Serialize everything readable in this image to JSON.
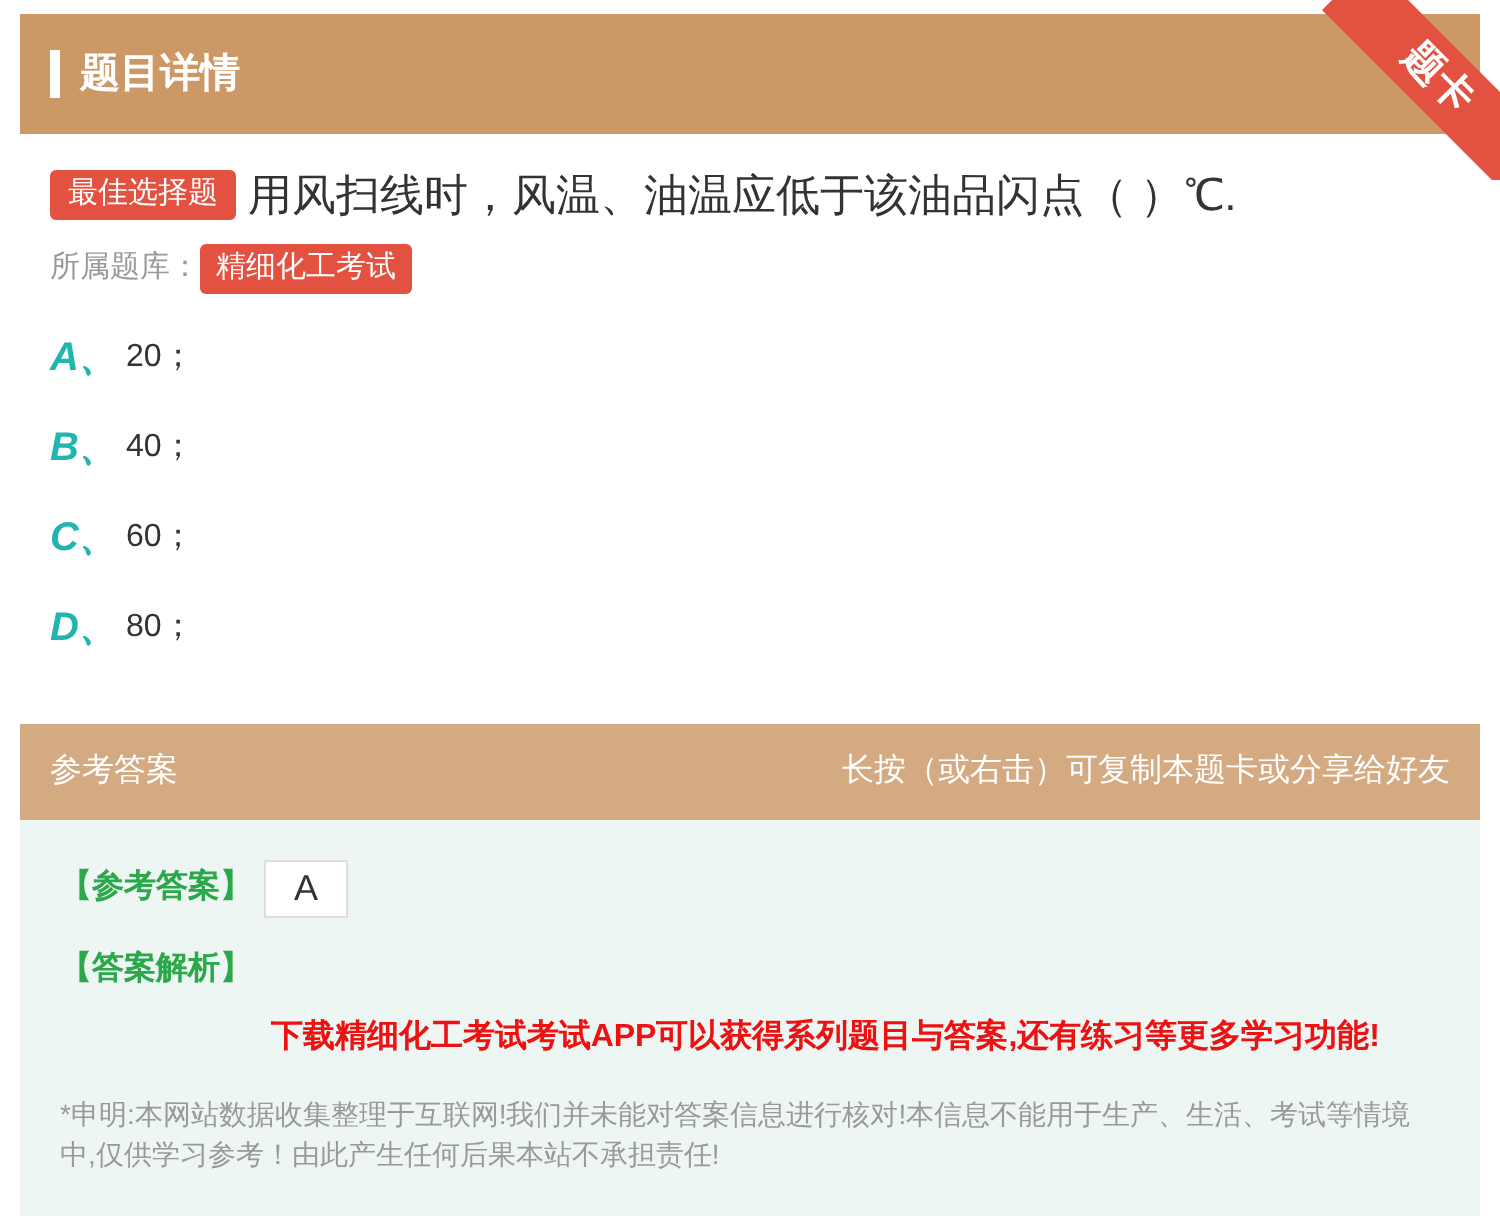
{
  "header": {
    "title": "题目详情",
    "ribbon": "题卡"
  },
  "question": {
    "type_badge": "最佳选择题",
    "text": "用风扫线时，风温、油温应低于该油品闪点（ ）℃.",
    "bank_label": "所属题库：",
    "bank": "精细化工考试"
  },
  "options": [
    {
      "letter": "A",
      "sep": "、",
      "text": "20；"
    },
    {
      "letter": "B",
      "sep": "、",
      "text": "40；"
    },
    {
      "letter": "C",
      "sep": "、",
      "text": "60；"
    },
    {
      "letter": "D",
      "sep": "、",
      "text": "80；"
    }
  ],
  "answer_bar": {
    "title": "参考答案",
    "hint": "长按（或右击）可复制本题卡或分享给好友"
  },
  "answer": {
    "label": "【参考答案】",
    "value": "A",
    "analysis_label": "【答案解析】",
    "promo": "下载精细化工考试考试APP可以获得系列题目与答案,还有练习等更多学习功能!",
    "disclaimer": "*申明:本网站数据收集整理于互联网!我们并未能对答案信息进行核对!本信息不能用于生产、生活、考试等情境中,仅供学习参考！由此产生任何后果本站不承担责任!"
  }
}
